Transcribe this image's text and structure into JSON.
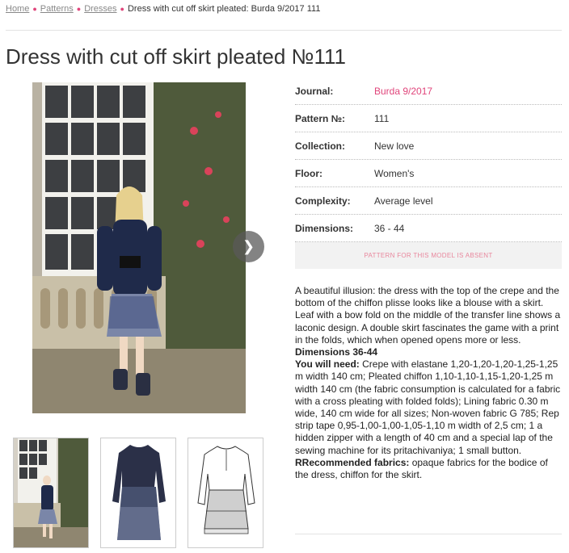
{
  "breadcrumb": {
    "items": [
      "Home",
      "Patterns",
      "Dresses"
    ],
    "current": "Dress with cut off skirt pleated: Burda 9/2017 111"
  },
  "title": "Dress with cut off skirt pleated №111",
  "details": [
    {
      "label": "Journal:",
      "value": "Burda 9/2017"
    },
    {
      "label": "Pattern №:",
      "value": "111"
    },
    {
      "label": "Collection:",
      "value": "New love"
    },
    {
      "label": "Floor:",
      "value": "Women's"
    },
    {
      "label": "Complexity:",
      "value": "Average level"
    },
    {
      "label": "Dimensions:",
      "value": "36 - 44"
    }
  ],
  "absent_button": "PATTERN FOR THIS MODEL IS ABSENT",
  "description": {
    "intro": "A beautiful illusion: the dress with the top of the crepe and the bottom of the chiffon plisse looks like a blouse with a skirt. Leaf with a bow fold on the middle of the transfer line shows a laconic design. A double skirt fascinates the game with a print in the folds, which when opened opens more or less.",
    "dimensions": "Dimensions 36-44",
    "need_label": "You will need:",
    "need_text": " Crepe with elastane 1,20-1,20-1,20-1,25-1,25 m width 140 cm; Pleated chiffon 1,10-1,10-1,15-1,20-1,25 m width 140 cm (the fabric consumption is calculated for a fabric with a cross pleating with folded folds); Lining fabric 0.30 m wide, 140 cm wide for all sizes; Non-woven fabric G 785; Rep strip tape 0,95-1,00-1,00-1,05-1,10 m width of 2,5 cm; 1 a hidden zipper with a length of 40 cm and a special lap of the sewing machine for its pritachivaniya; 1 small button.",
    "fabrics_label": "RRecommended fabrics:",
    "fabrics_text": " opaque fabrics for the bodice of the dress, chiffon for the skirt."
  },
  "icons": {
    "next": "chevron-right-icon"
  },
  "colors": {
    "accent": "#e0457b",
    "absent_text": "#e8879d"
  }
}
